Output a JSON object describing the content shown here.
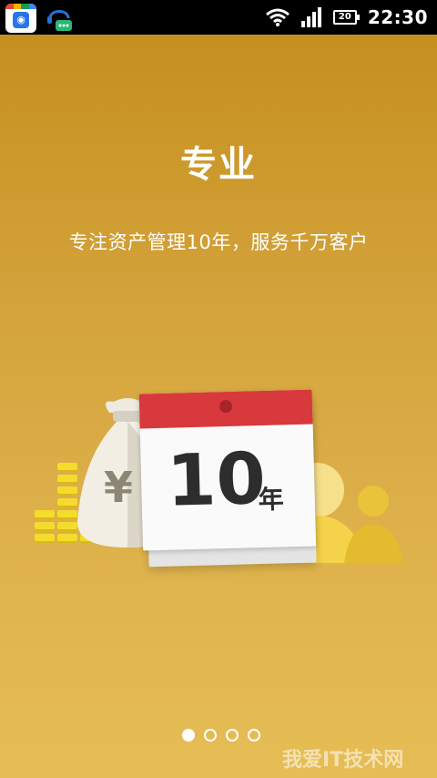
{
  "status_bar": {
    "battery_level": "20",
    "time": "22:30",
    "icons": [
      "baidu-app-icon",
      "chat-headset-icon",
      "wifi-icon",
      "signal-icon",
      "battery-icon"
    ]
  },
  "splash": {
    "headline": "专业",
    "subtitle": "专注资产管理10年，服务千万客户",
    "calendar_number": "10",
    "calendar_unit": "年",
    "money_bag_symbol": "¥",
    "page_count": 4,
    "active_page": 1,
    "colors": {
      "background_top": "#c6901f",
      "background_bottom": "#e6bd55",
      "calendar_red": "#d8393c",
      "coin_yellow": "#f4dc2c"
    }
  },
  "watermark": {
    "text": "我爱IT技术网"
  }
}
